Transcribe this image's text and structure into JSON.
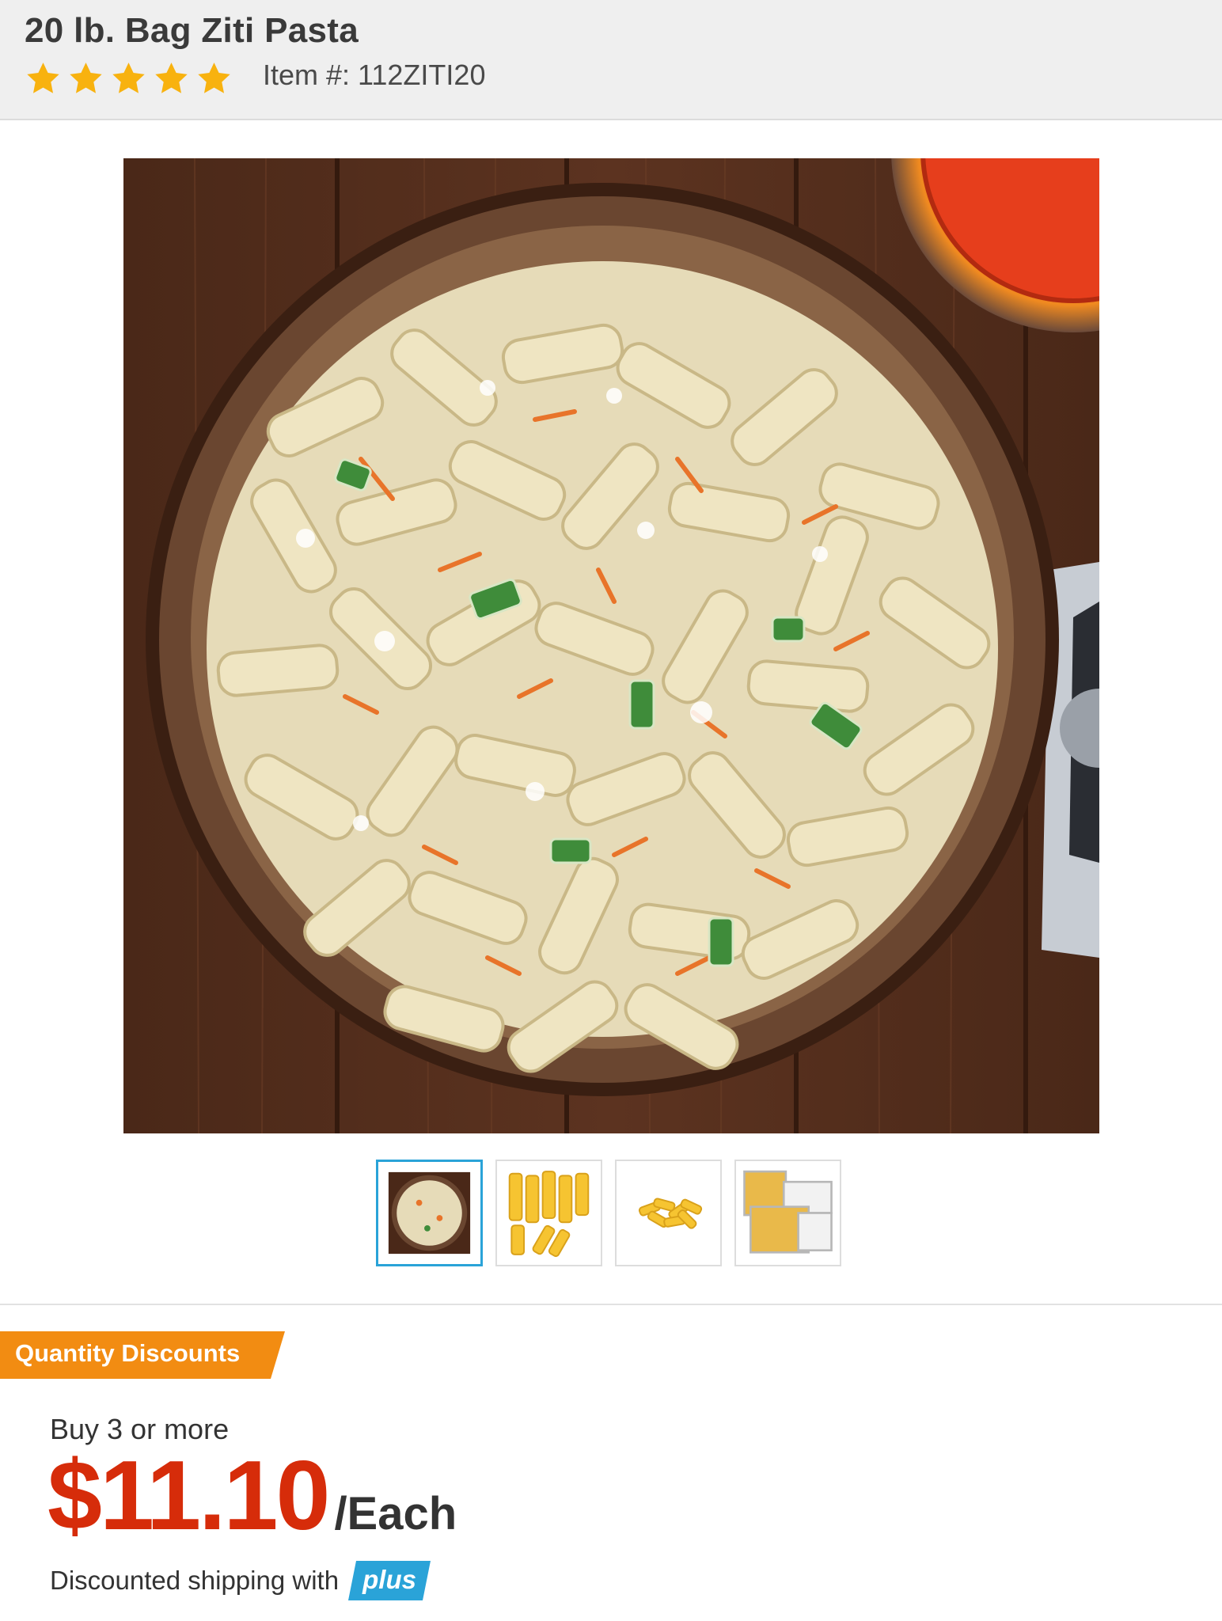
{
  "product": {
    "title": "20 lb. Bag Ziti Pasta",
    "rating_stars": 5,
    "rating_max": 5,
    "item_number_label": "Item #: 112ZITI20"
  },
  "gallery": {
    "main_image": "pasta-salad-bowl-photo",
    "thumbnails": [
      {
        "name": "pasta-salad-bowl-thumbnail",
        "selected": true
      },
      {
        "name": "ziti-pieces-thumbnail",
        "selected": false
      },
      {
        "name": "ziti-pile-thumbnail",
        "selected": false
      },
      {
        "name": "ziti-in-containers-thumbnail",
        "selected": false
      }
    ]
  },
  "discounts": {
    "badge_label": "Quantity Discounts",
    "tier_label": "Buy 3 or more",
    "price": "$11.10",
    "unit": "/Each"
  },
  "shipping": {
    "text": "Discounted shipping with",
    "plus_label": "plus"
  },
  "colors": {
    "star": "#f8b20f",
    "badge_orange": "#f28c12",
    "price_red": "#d62c0a",
    "plus_blue": "#2aa3d8",
    "selected_border": "#2aa3d8"
  }
}
